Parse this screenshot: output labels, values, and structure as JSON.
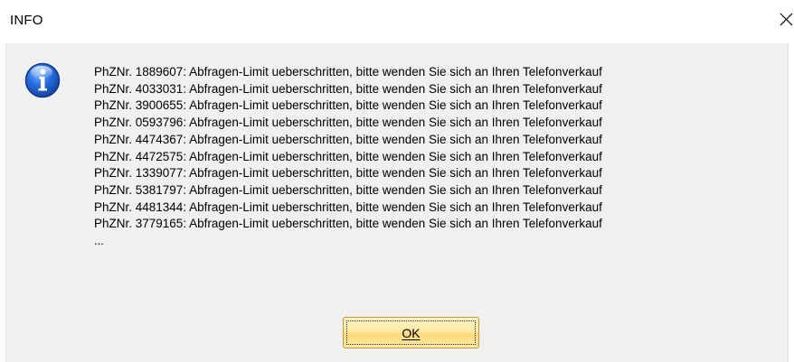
{
  "window": {
    "title": "INFO",
    "close_glyph": "×"
  },
  "icon": "info-icon",
  "messages": [
    "PhZNr. 1889607: Abfragen-Limit ueberschritten, bitte wenden Sie sich an Ihren Telefonverkauf",
    "PhZNr. 4033031: Abfragen-Limit ueberschritten, bitte wenden Sie sich an Ihren Telefonverkauf",
    "PhZNr. 3900655: Abfragen-Limit ueberschritten, bitte wenden Sie sich an Ihren Telefonverkauf",
    "PhZNr. 0593796: Abfragen-Limit ueberschritten, bitte wenden Sie sich an Ihren Telefonverkauf",
    "PhZNr. 4474367: Abfragen-Limit ueberschritten, bitte wenden Sie sich an Ihren Telefonverkauf",
    "PhZNr. 4472575: Abfragen-Limit ueberschritten, bitte wenden Sie sich an Ihren Telefonverkauf",
    "PhZNr. 1339077: Abfragen-Limit ueberschritten, bitte wenden Sie sich an Ihren Telefonverkauf",
    "PhZNr. 5381797: Abfragen-Limit ueberschritten, bitte wenden Sie sich an Ihren Telefonverkauf",
    "PhZNr. 4481344: Abfragen-Limit ueberschritten, bitte wenden Sie sich an Ihren Telefonverkauf",
    "PhZNr. 3779165: Abfragen-Limit ueberschritten, bitte wenden Sie sich an Ihren Telefonverkauf"
  ],
  "more_indicator": "...",
  "buttons": {
    "ok_label": "OK"
  },
  "colors": {
    "panel_background": "#f0f0f0",
    "button_gradient_top": "#fff4c8",
    "button_gradient_bottom": "#ffd97a",
    "button_border": "#c39b2e",
    "icon_blue": "#1f5fc4"
  }
}
